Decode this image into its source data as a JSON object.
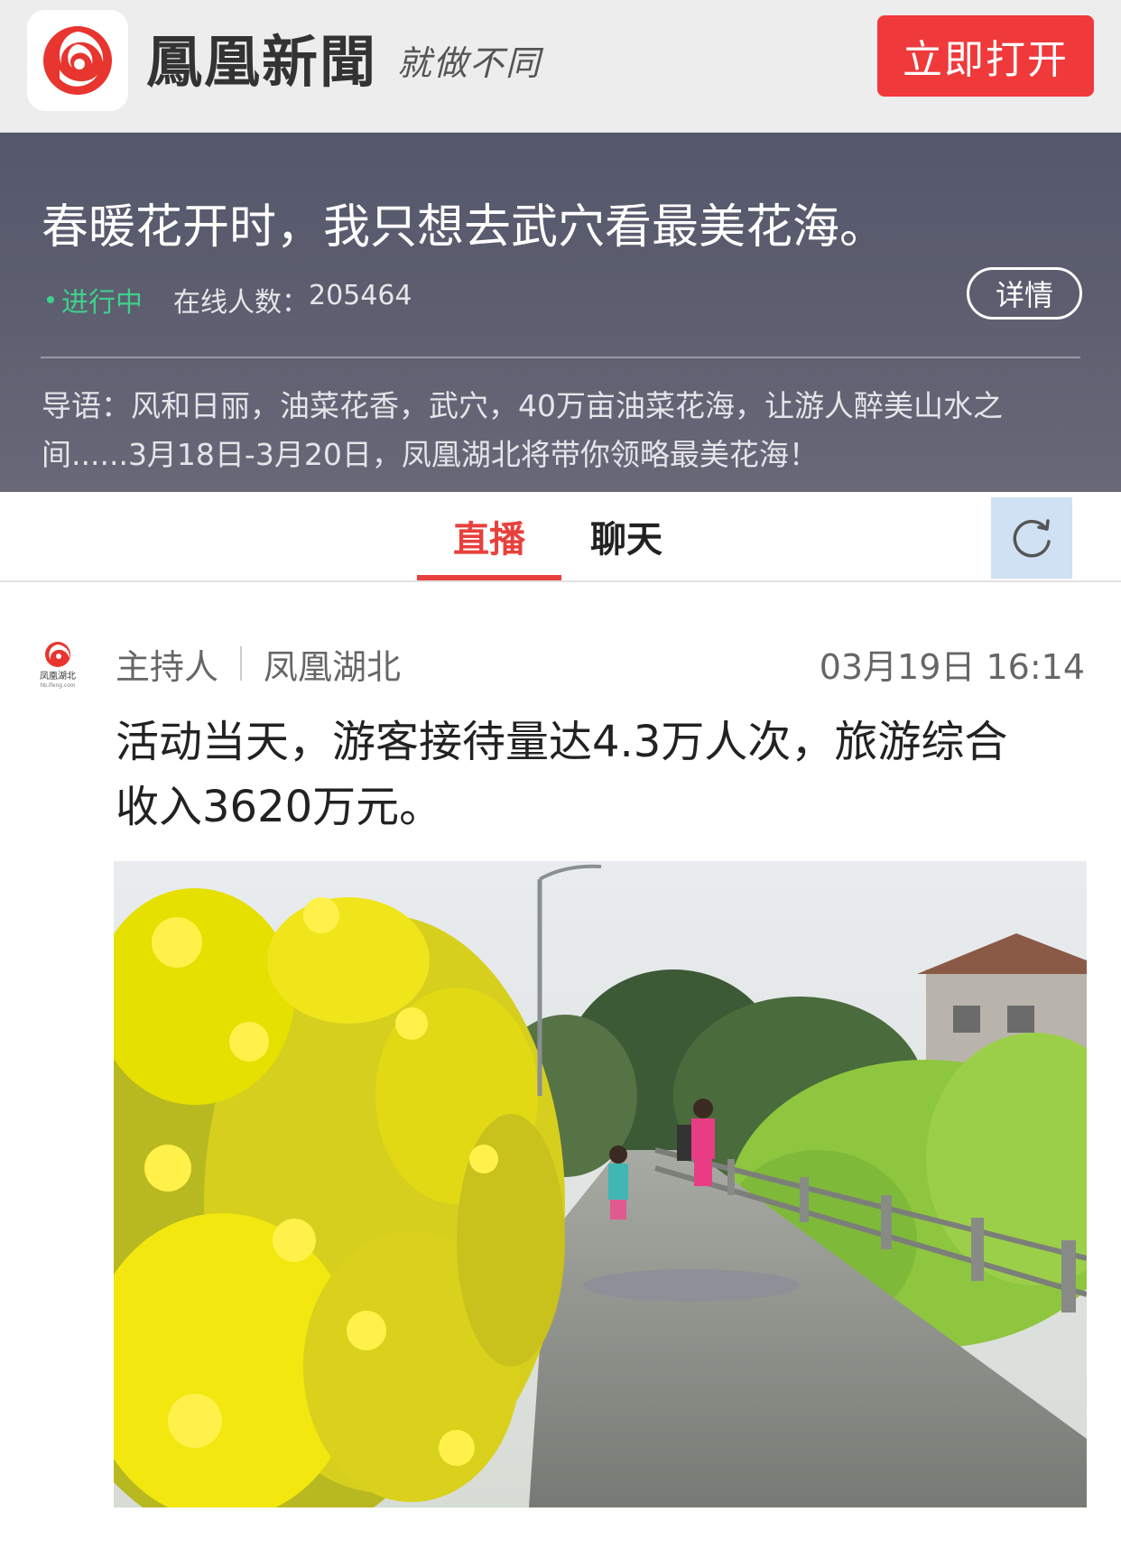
{
  "appbar": {
    "brand_name": "鳳凰新聞",
    "slogan": "就做不同",
    "open_button": "立即打开",
    "logo_icon": "ifeng-phoenix-logo-icon"
  },
  "live": {
    "title": "春暖花开时，我只想去武穴看最美花海。",
    "status": "进行中",
    "online_label": "在线人数",
    "online_sep": "：",
    "online_count": "205464",
    "detail_button": "详情",
    "intro": "导语：风和日丽，油菜花香，武穴，40万亩油菜花海，让游人醉美山水之间......3月18日-3月20日，凤凰湖北将带你领略最美花海！"
  },
  "tabs": {
    "items": [
      {
        "label": "直播",
        "active": true
      },
      {
        "label": "聊天",
        "active": false
      }
    ],
    "refresh_icon": "refresh-icon"
  },
  "post": {
    "role": "主持人",
    "author": "凤凰湖北",
    "time": "03月19日 16:14",
    "avatar_text": "凤凰湖北",
    "avatar_url_text": "hb.ifeng.com",
    "text": "活动当天，游客接待量达4.3万人次，旅游综合收入3620万元。",
    "photo_icon": "rapeseed-flower-path-photo"
  },
  "colors": {
    "accent_red": "#f0393b",
    "live_green": "#3fd08a",
    "banner_bg": "#5b5d6f",
    "refresh_bg": "#cfe1f2"
  }
}
